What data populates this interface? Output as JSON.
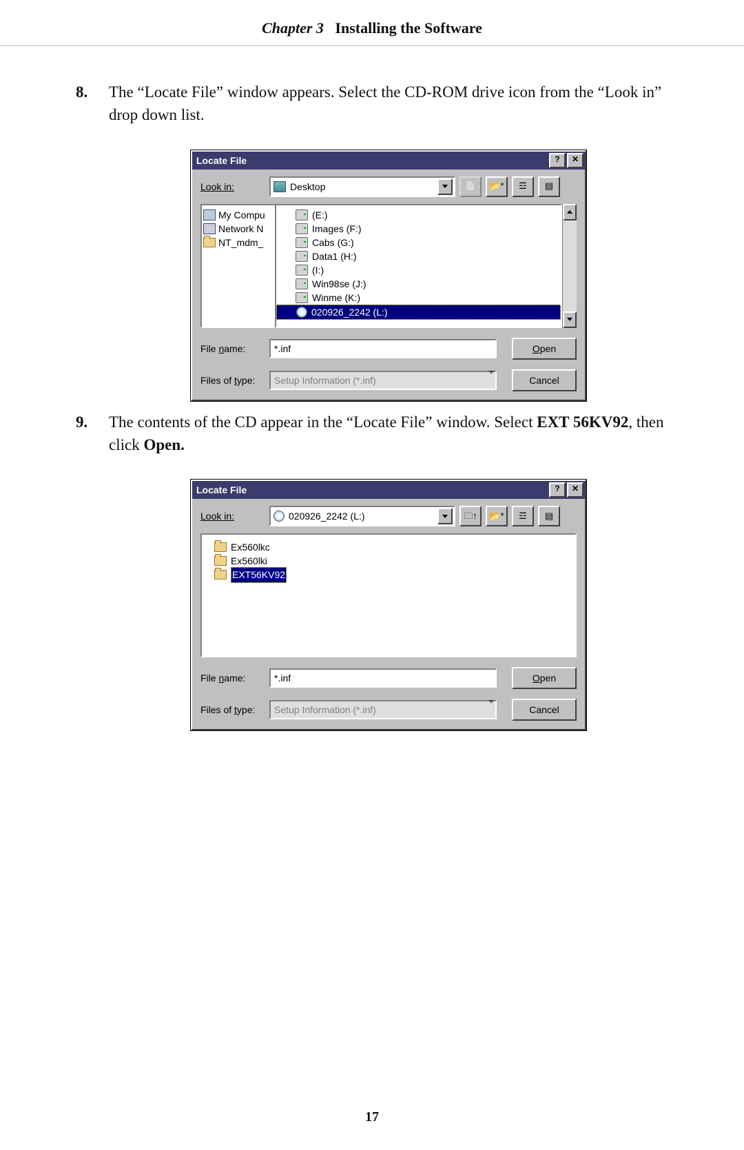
{
  "header": {
    "chapter": "Chapter 3",
    "title": "Installing the Software"
  },
  "steps": {
    "8": {
      "num": "8.",
      "text_a": "The “Locate File” window appears. Select the CD-ROM drive icon from the “Look in” drop down list."
    },
    "9": {
      "num": "9.",
      "text_a": "The contents of the CD appear in the “Locate File” window. Select ",
      "bold1": "EXT 56KV92",
      "text_b": ", then click ",
      "bold2": "Open."
    }
  },
  "dlg1": {
    "title": "Locate File",
    "help": "?",
    "close": "✕",
    "look_label": "Look in:",
    "look_value": "Desktop",
    "tb": {
      "up": "↰",
      "new": "✨",
      "list": "☰",
      "det": "☷"
    },
    "left": [
      {
        "icon": "comp",
        "label": "My Compu"
      },
      {
        "icon": "net",
        "label": "Network N"
      },
      {
        "icon": "fold",
        "label": "NT_mdm_"
      }
    ],
    "drop": [
      {
        "icon": "drive",
        "label": "(E:)"
      },
      {
        "icon": "drive",
        "label": "Images (F:)"
      },
      {
        "icon": "drive",
        "label": "Cabs (G:)"
      },
      {
        "icon": "drive",
        "label": "Data1 (H:)"
      },
      {
        "icon": "drive",
        "label": "(I:)"
      },
      {
        "icon": "drive",
        "label": "Win98se (J:)"
      },
      {
        "icon": "drive",
        "label": "Winme (K:)"
      },
      {
        "icon": "cd",
        "label": "020926_2242 (L:)",
        "selected": true
      }
    ],
    "file_name_label": "File name:",
    "file_name_value": "*.inf",
    "file_type_label": "Files of type:",
    "file_type_value": "Setup Information (*.inf)",
    "open": "Open",
    "cancel": "Cancel"
  },
  "dlg2": {
    "title": "Locate File",
    "help": "?",
    "close": "✕",
    "look_label": "Look in:",
    "look_value": "020926_2242 (L:)",
    "tb": {
      "up": "↰",
      "new": "✨",
      "list": "☰",
      "det": "☷"
    },
    "files": [
      {
        "icon": "fold",
        "label": "Ex560lkc"
      },
      {
        "icon": "fold",
        "label": "Ex560lki"
      },
      {
        "icon": "fold",
        "label": "EXT56KV92",
        "selected": true
      }
    ],
    "file_name_label": "File name:",
    "file_name_value": "*.inf",
    "file_type_label": "Files of type:",
    "file_type_value": "Setup Information (*.inf)",
    "open": "Open",
    "cancel": "Cancel"
  },
  "page_num": "17"
}
